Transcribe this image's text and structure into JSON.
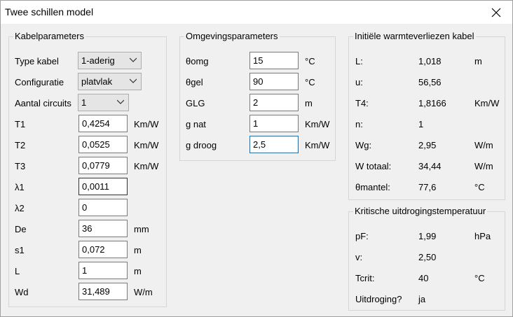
{
  "window": {
    "title": "Twee schillen model"
  },
  "kabel": {
    "legend": "Kabelparameters",
    "type_kabel": {
      "label": "Type kabel",
      "value": "1-aderig"
    },
    "configuratie": {
      "label": "Configuratie",
      "value": "platvlak"
    },
    "aantal_circuits": {
      "label": "Aantal circuits",
      "value": "1"
    },
    "rows": [
      {
        "label": "T1",
        "value": "0,4254",
        "unit": "Km/W"
      },
      {
        "label": "T2",
        "value": "0,0525",
        "unit": "Km/W"
      },
      {
        "label": "T3",
        "value": "0,0779",
        "unit": "Km/W"
      },
      {
        "label": "λ1",
        "value": "0,0011",
        "unit": ""
      },
      {
        "label": "λ2",
        "value": "0",
        "unit": ""
      },
      {
        "label": "De",
        "value": "36",
        "unit": "mm"
      },
      {
        "label": "s1",
        "value": "0,072",
        "unit": "m"
      },
      {
        "label": "L",
        "value": "1",
        "unit": "m"
      },
      {
        "label": "Wd",
        "value": "31,489",
        "unit": "W/m"
      }
    ]
  },
  "omgeving": {
    "legend": "Omgevingsparameters",
    "rows": [
      {
        "label": "θomg",
        "value": "15",
        "unit": "°C"
      },
      {
        "label": "θgel",
        "value": "90",
        "unit": "°C"
      },
      {
        "label": "GLG",
        "value": "2",
        "unit": "m"
      },
      {
        "label": "g nat",
        "value": "1",
        "unit": "Km/W"
      },
      {
        "label": "g droog",
        "value": "2,5",
        "unit": "Km/W"
      }
    ]
  },
  "warmte": {
    "legend": "Initiële warmteverliezen kabel",
    "rows": [
      {
        "label": "L:",
        "value": "1,018",
        "unit": "m"
      },
      {
        "label": "u:",
        "value": "56,56",
        "unit": ""
      },
      {
        "label": "T4:",
        "value": "1,8166",
        "unit": "Km/W"
      },
      {
        "label": "n:",
        "value": "1",
        "unit": ""
      },
      {
        "label": "Wg:",
        "value": "2,95",
        "unit": "W/m"
      },
      {
        "label": "W totaal:",
        "value": "34,44",
        "unit": "W/m"
      },
      {
        "label": "θmantel:",
        "value": "77,6",
        "unit": "°C"
      }
    ]
  },
  "kritisch": {
    "legend": "Kritische uitdrogingstemperatuur",
    "rows": [
      {
        "label": "pF:",
        "value": "1,99",
        "unit": "hPa"
      },
      {
        "label": "v:",
        "value": "2,50",
        "unit": ""
      },
      {
        "label": "Tcrit:",
        "value": "40",
        "unit": "°C"
      },
      {
        "label": "Uitdroging?",
        "value": "ja",
        "unit": ""
      }
    ]
  }
}
